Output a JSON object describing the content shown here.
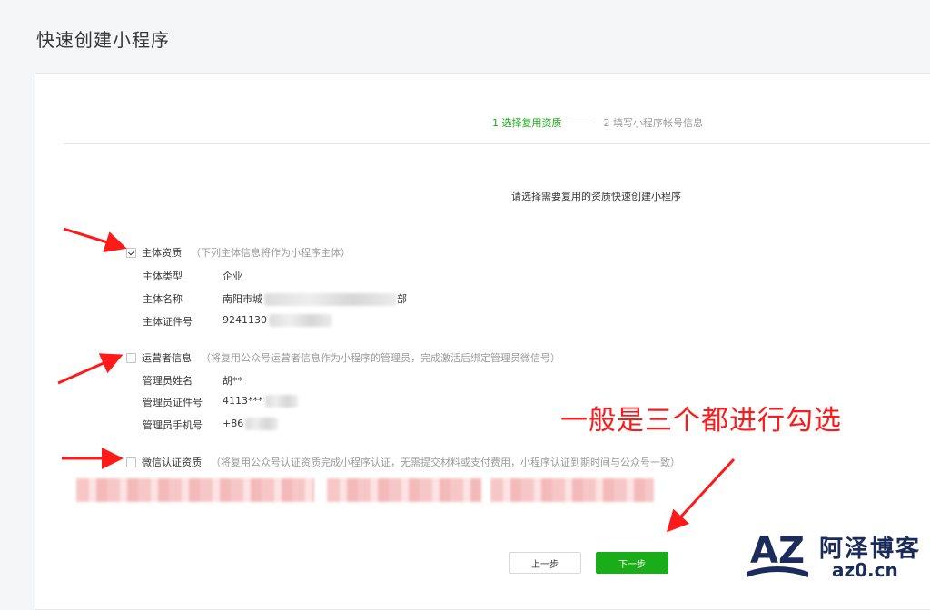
{
  "page": {
    "title": "快速创建小程序"
  },
  "steps": [
    {
      "label": "1 选择复用资质",
      "state": "active"
    },
    {
      "label": "2 填写小程序帐号信息",
      "state": "inactive"
    }
  ],
  "intro": "请选择需要复用的资质快速创建小程序",
  "sections": {
    "subject": {
      "label": "主体资质",
      "note": "（下列主体信息将作为小程序主体）",
      "checked": true,
      "rows": [
        {
          "key": "主体类型",
          "value": "企业"
        },
        {
          "key": "主体名称",
          "value": "南阳市城",
          "suffix": "部"
        },
        {
          "key": "主体证件号",
          "value": "9241130"
        }
      ]
    },
    "operator": {
      "label": "运营者信息",
      "note": "（将复用公众号运营者信息作为小程序的管理员，完成激活后绑定管理员微信号）",
      "checked": false,
      "rows": [
        {
          "key": "管理员姓名",
          "value": "胡**"
        },
        {
          "key": "管理员证件号",
          "value": "4113***"
        },
        {
          "key": "管理员手机号",
          "value": "+86"
        }
      ]
    },
    "wechat_auth": {
      "label": "微信认证资质",
      "note": "（将复用公众号认证资质完成小程序认证，无需提交材料或支付费用，小程序认证到期时间与公众号一致）",
      "checked": false
    }
  },
  "annotation": "一般是三个都进行勾选",
  "buttons": {
    "prev": "上一步",
    "next": "下一步"
  },
  "watermark": {
    "mark": "AZ",
    "name": "阿泽博客",
    "url": "az0.cn"
  },
  "colors": {
    "accent": "#1aad19",
    "annotation": "#ff1a1a",
    "logo": "#1c2c5a"
  }
}
